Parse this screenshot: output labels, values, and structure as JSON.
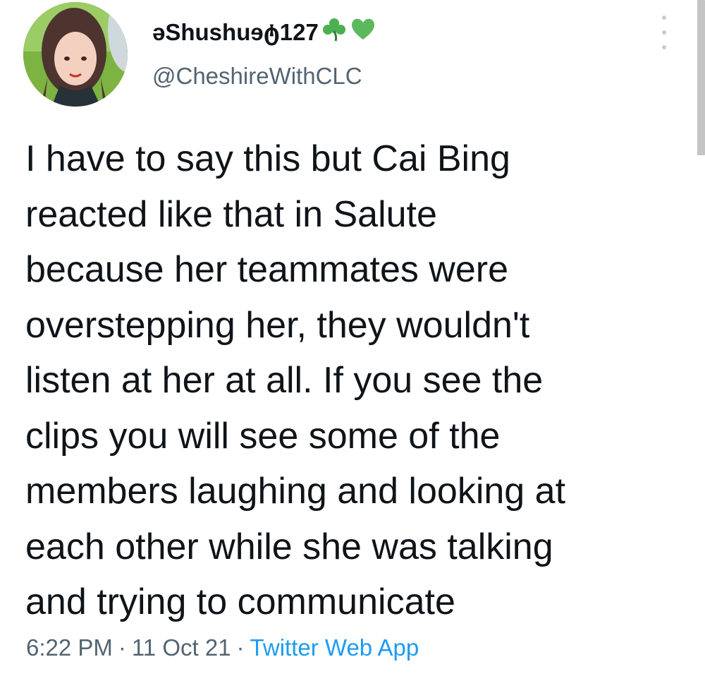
{
  "author": {
    "display_name": "əShushuɘტ127",
    "emoji": [
      "shamrock-icon",
      "green-heart-icon"
    ],
    "handle": "@CheshireWithCLC",
    "avatar": "profile-photo"
  },
  "tweet": {
    "lines": [
      "I have to say this but Cai Bing",
      "reacted like that in Salute",
      "because her teammates were",
      "overstepping her, they wouldn't",
      "listen at her at all. If you see the",
      "clips you will see some of the",
      "members laughing and looking at",
      "each other while she was talking",
      "and trying to communicate"
    ]
  },
  "meta": {
    "time": "6:22 PM",
    "separator": "·",
    "date": "11 Oct 21",
    "source": "Twitter Web App"
  },
  "colors": {
    "text": "#0f1419",
    "secondary": "#536471",
    "link": "#1d9bf0",
    "emoji_green": "#4caf50"
  }
}
